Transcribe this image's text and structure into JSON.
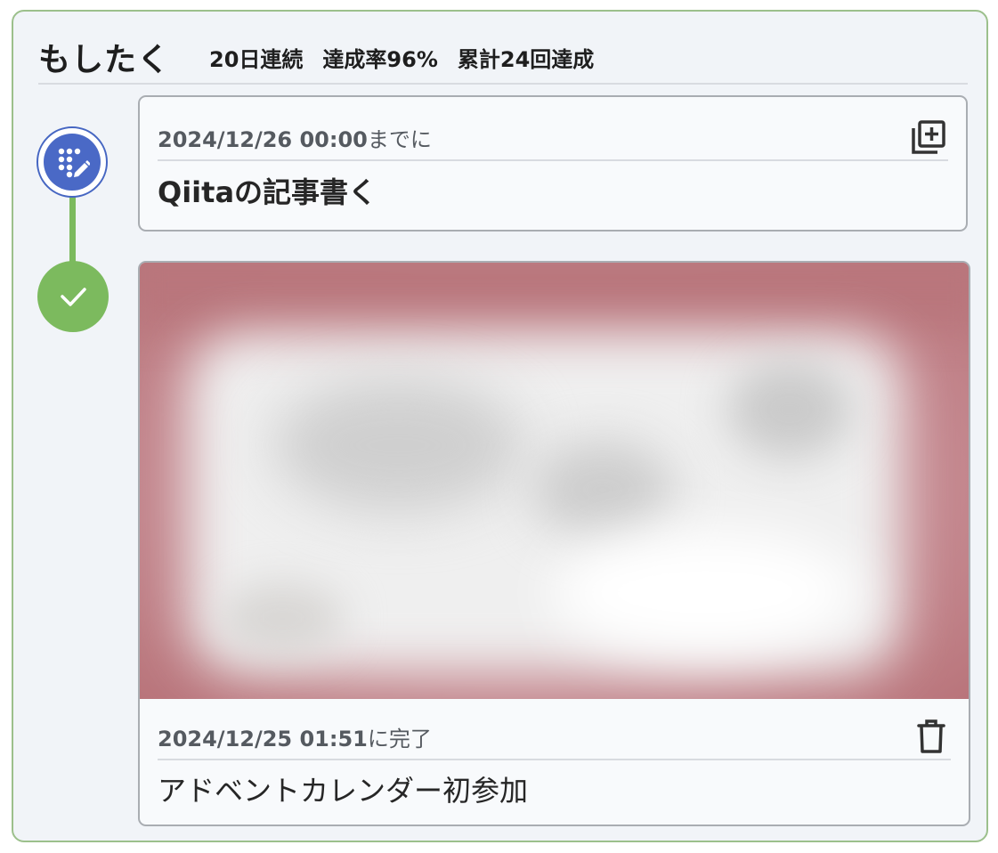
{
  "header": {
    "title": "もしたく",
    "streak": "20日連続",
    "rate": "達成率96%",
    "total": "累計24回達成"
  },
  "task": {
    "deadline_datetime": "2024/12/26 00:00",
    "deadline_suffix": "までに",
    "title": "Qiitaの記事書く",
    "node_icon": "task-edit-icon",
    "action_icon": "add-photo-icon"
  },
  "done": {
    "completed_datetime": "2024/12/25 01:51",
    "completed_suffix": "に完了",
    "title": "アドベントカレンダー初参加",
    "node_icon": "check-icon",
    "action_icon": "trash-icon",
    "photo_description_visible": false
  },
  "colors": {
    "panel_border": "#9cc08c",
    "panel_bg": "#f1f4f8",
    "task_node": "#4a69c6",
    "done_node": "#7cba5e",
    "timeline": "#7cba5e"
  }
}
